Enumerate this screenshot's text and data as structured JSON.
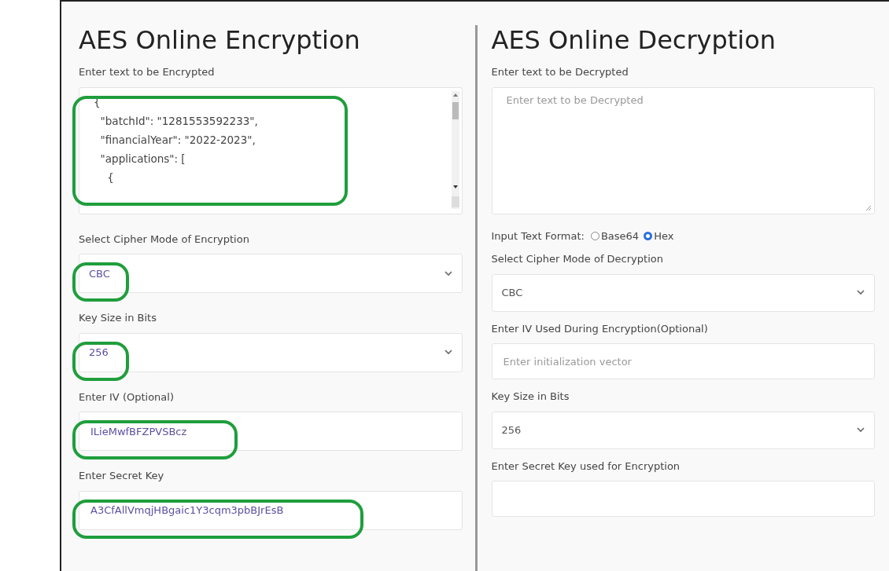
{
  "encryption": {
    "title": "AES Online Encryption",
    "fields": [
      {
        "kind": "textarea",
        "label": "Enter text to be Encrypted",
        "lines": [
          "{",
          "  \"batchId\": \"1281553592233\",",
          "  \"financialYear\": \"2022-2023\",",
          "  \"applications\": [",
          "    {"
        ],
        "highlighted": true
      },
      {
        "kind": "select",
        "label": "Select Cipher Mode of Encryption",
        "value": "CBC",
        "highlighted": true
      },
      {
        "kind": "select",
        "label": "Key Size in Bits",
        "value": "256",
        "highlighted": true
      },
      {
        "kind": "input",
        "label": "Enter IV (Optional)",
        "value": "ILieMwfBFZPVSBcz",
        "highlighted": true
      },
      {
        "kind": "input",
        "label": "Enter Secret Key",
        "value": "A3CfAllVmqjHBgaic1Y3cqm3pbBJrEsB",
        "highlighted": true
      }
    ]
  },
  "decryption": {
    "title": "AES Online Decryption",
    "fields": [
      {
        "kind": "textarea",
        "label": "Enter text to be Decrypted",
        "placeholder": "Enter text to be Decrypted",
        "highlighted": false
      },
      {
        "kind": "radio",
        "label": "Input Text Format:",
        "options": [
          {
            "label": "Base64",
            "selected": false
          },
          {
            "label": "Hex",
            "selected": true
          }
        ]
      },
      {
        "kind": "select",
        "label": "Select Cipher Mode of Decryption",
        "value": "CBC",
        "highlighted": false
      },
      {
        "kind": "input",
        "label": "Enter IV Used During Encryption(Optional)",
        "placeholder": "Enter initialization vector",
        "highlighted": false
      },
      {
        "kind": "select",
        "label": "Key Size in Bits",
        "value": "256",
        "highlighted": false
      },
      {
        "kind": "input",
        "label": "Enter Secret Key used for Encryption",
        "highlighted": false
      }
    ]
  }
}
